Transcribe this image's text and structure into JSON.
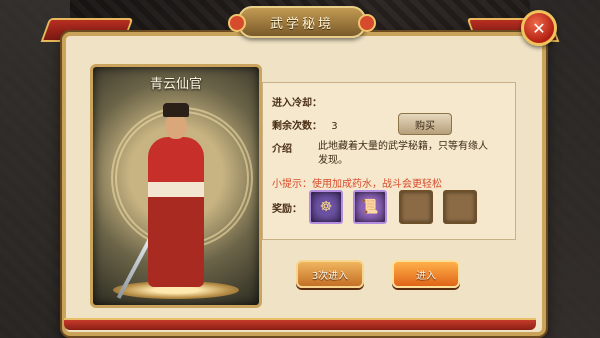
{
  "window": {
    "title": "武学秘境",
    "close_icon": "close-icon"
  },
  "portrait": {
    "name": "青云仙官"
  },
  "info": {
    "cooldown_label": "进入冷却：",
    "remaining_label": "剩余次数：",
    "remaining_value": "3",
    "buy_label": "购买",
    "intro_label": "介绍",
    "intro_text": "此地藏着大量的武学秘籍，只等有缘人发现。",
    "tip_text": "小提示：使用加成药水，战斗会更轻松",
    "reward_label": "奖励："
  },
  "rewards": [
    {
      "icon": "sitting-monk-icon",
      "filled": true
    },
    {
      "icon": "scroll-book-icon",
      "filled": true
    },
    {
      "icon": "empty-slot",
      "filled": false
    },
    {
      "icon": "empty-slot",
      "filled": false
    }
  ],
  "actions": {
    "enter_three_label": "3次进入",
    "enter_label": "进入"
  },
  "colors": {
    "accent_red": "#c63a2a",
    "gold_trim": "#c9a35a",
    "panel_bg": "#f0e2c4",
    "tip_red": "#d84a2a"
  }
}
